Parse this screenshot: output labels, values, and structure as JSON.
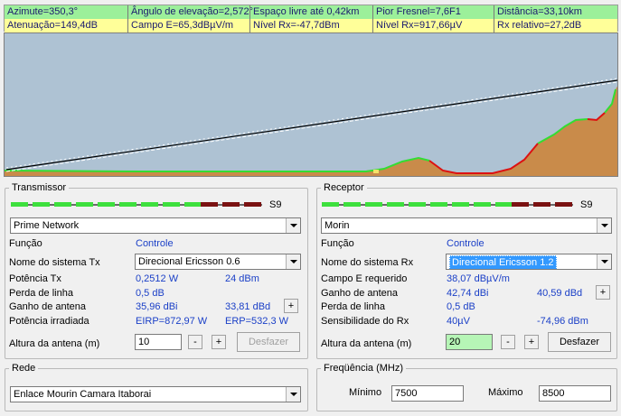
{
  "header": {
    "row1": [
      "Azimute=350,3°",
      "Ângulo de elevação=2,572°",
      "Espaço livre até 0,42km",
      "Pior Fresnel=7,6F1",
      "Distância=33,10km"
    ],
    "row2": [
      "Atenuação=149,4dB",
      "Campo E=65,3dBµV/m",
      "Nível Rx=-47,7dBm",
      "Nível Rx=917,66µV",
      "Rx relativo=27,2dB"
    ]
  },
  "profile": {
    "colors": {
      "sky": "#aec2d3",
      "terrain": "#c98b4a",
      "green_ground": "#33dd33",
      "obstruction": "#dd1111"
    }
  },
  "transmitter": {
    "legend": "Transmissor",
    "meter_label": "S9",
    "meter_green_segments": 10,
    "meter_red_segments": 3,
    "network": "Prime Network",
    "function_label": "Função",
    "function_value": "Controle",
    "system_label": "Nome do sistema Tx",
    "system_value": "Direcional  Ericsson 0.6",
    "power_label": "Potência Tx",
    "power_w": "0,2512 W",
    "power_dbm": "24 dBm",
    "line_loss_label": "Perda de linha",
    "line_loss": "0,5 dB",
    "gain_label": "Ganho de antena",
    "gain_dbi": "35,96 dBi",
    "gain_dbd": "33,81 dBd",
    "radiated_label": "Potência irradiada",
    "eirp": "EIRP=872,97 W",
    "erp": "ERP=532,3 W",
    "height_label": "Altura da antena (m)",
    "height_value": "10",
    "minus": "-",
    "plus": "+",
    "undo": "Desfazer"
  },
  "receiver": {
    "legend": "Receptor",
    "meter_label": "S9",
    "meter_green_segments": 10,
    "meter_red_segments": 3,
    "network": "Morin",
    "function_label": "Função",
    "function_value": "Controle",
    "system_label": "Nome do sistema Rx",
    "system_value": "Direcional Ericsson 1.2",
    "efield_label": "Campo E requerido",
    "efield_value": "38,07 dBµV/m",
    "gain_label": "Ganho de antena",
    "gain_dbi": "42,74 dBi",
    "gain_dbd": "40,59 dBd",
    "line_loss_label": "Perda de linha",
    "line_loss": "0,5 dB",
    "sensitivity_label": "Sensibilidade do Rx",
    "sensitivity_uv": "40µV",
    "sensitivity_dbm": "-74,96 dBm",
    "height_label": "Altura da antena (m)",
    "height_value": "20",
    "minus": "-",
    "plus": "+",
    "undo": "Desfazer"
  },
  "network": {
    "legend": "Rede",
    "value": "Enlace Mourin Camara Itaborai"
  },
  "frequency": {
    "legend": "Freqüência (MHz)",
    "min_label": "Mínimo",
    "min_value": "7500",
    "max_label": "Máximo",
    "max_value": "8500"
  }
}
